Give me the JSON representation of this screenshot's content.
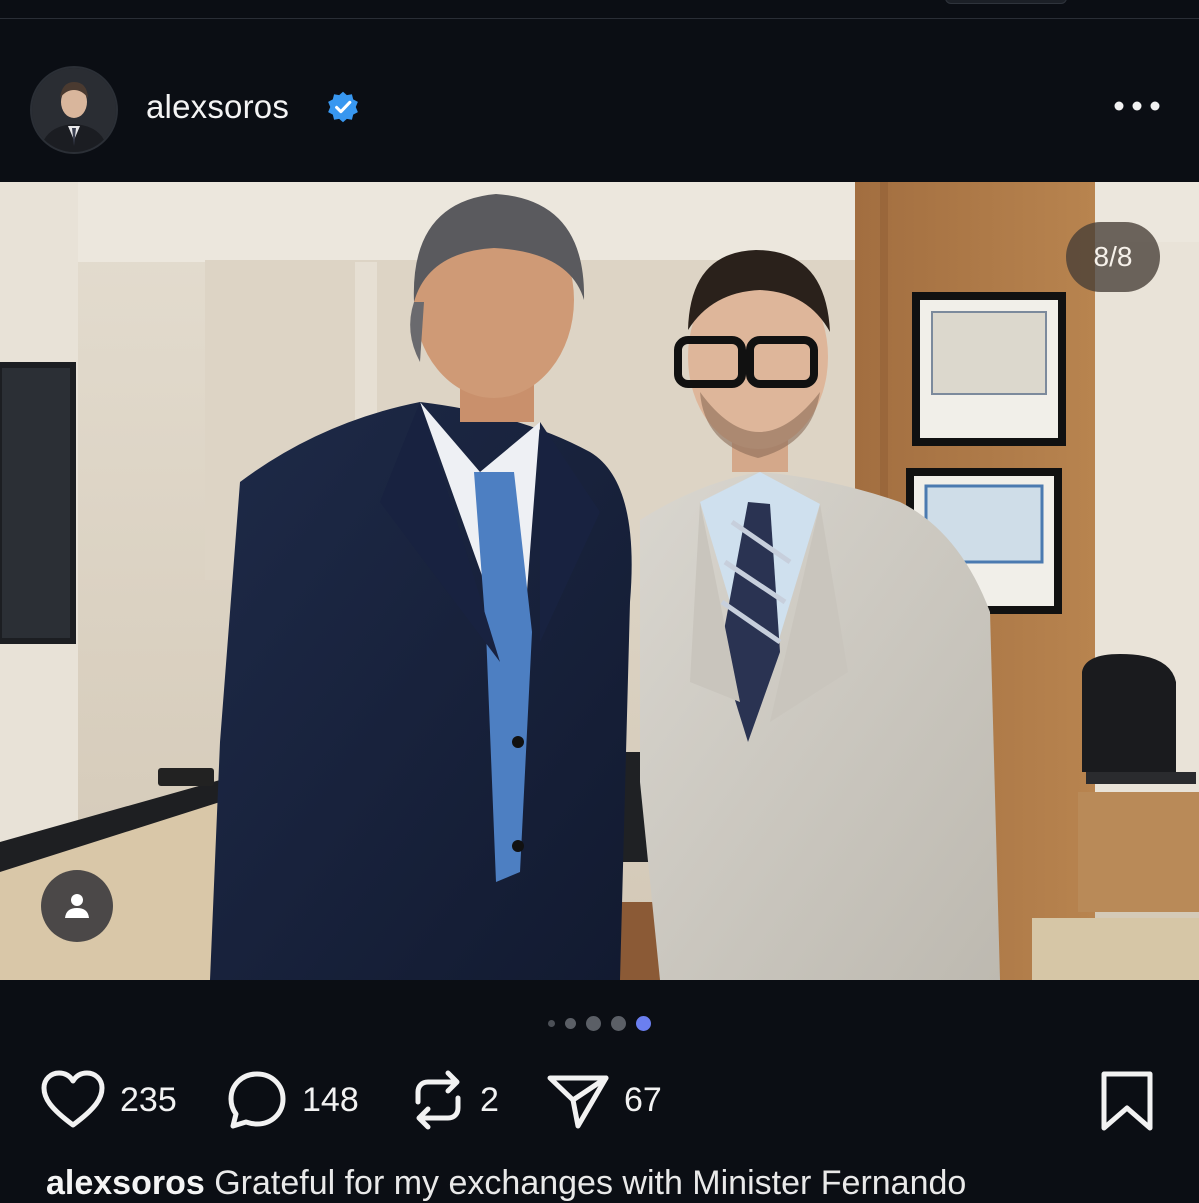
{
  "post": {
    "username": "alexsoros",
    "verified_icon": "verified-badge-icon",
    "more_icon": "more-options-icon",
    "photo_counter": "8/8",
    "carousel": {
      "total_dots": 5,
      "active_index": 4
    },
    "colors": {
      "verified": "#3897f0",
      "active_dot": "#6b7ff0"
    }
  },
  "actions": {
    "likes": "235",
    "comments": "148",
    "reposts": "2",
    "shares": "67"
  },
  "caption": {
    "username": "alexsoros",
    "text": "Grateful for my exchanges with Minister Fernando"
  }
}
